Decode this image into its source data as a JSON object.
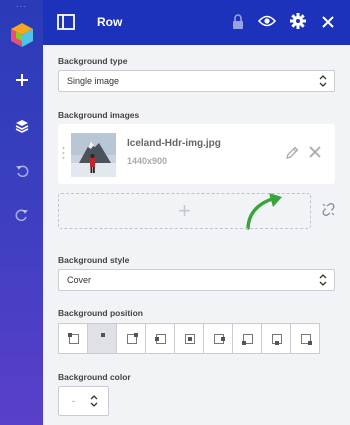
{
  "rail": {
    "dots": "···",
    "icons": [
      "add-icon",
      "layers-icon",
      "undo-icon",
      "redo-icon"
    ]
  },
  "topbar": {
    "title": "Row",
    "icons": [
      "layout-icon",
      "lock-icon",
      "eye-icon",
      "gear-icon",
      "close-icon"
    ]
  },
  "background_type": {
    "label": "Background type",
    "value": "Single image"
  },
  "background_images": {
    "label": "Background images",
    "file_name": "Iceland-Hdr-img.jpg",
    "file_size": "1440x900",
    "add_symbol": "+"
  },
  "background_style": {
    "label": "Background style",
    "value": "Cover"
  },
  "background_position": {
    "label": "Background position",
    "options": [
      "left-top",
      "center-top",
      "right-top",
      "left-center",
      "center-center",
      "right-center",
      "left-bottom",
      "center-bottom",
      "right-bottom"
    ],
    "selected": "center-top"
  },
  "background_color": {
    "label": "Background color",
    "value": "-"
  },
  "colors": {
    "topbar": "#1c32ba",
    "accent_arrow": "#3aa33a"
  }
}
